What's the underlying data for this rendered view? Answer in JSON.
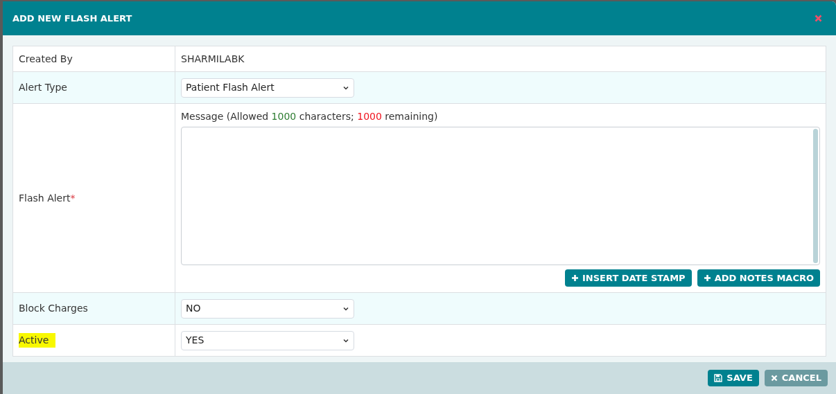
{
  "dialog": {
    "title": "ADD NEW FLASH ALERT"
  },
  "rows": [
    {
      "kind": "text",
      "label": "Created By",
      "value": "SHARMILABK",
      "highlighted": false
    },
    {
      "kind": "select",
      "label": "Alert Type",
      "value": "Patient Flash Alert",
      "highlighted": false
    },
    {
      "kind": "textarea",
      "label": "Flash Alert",
      "required_mark": "*",
      "highlighted": false,
      "counter": {
        "prefix": "Message (Allowed",
        "allowed": "1000",
        "middle": "characters;",
        "remaining": "1000",
        "suffix": "remaining)"
      },
      "buttons": [
        "INSERT DATE STAMP",
        "ADD NOTES MACRO"
      ]
    },
    {
      "kind": "select",
      "label": "Block Charges",
      "value": "NO",
      "highlighted": false
    },
    {
      "kind": "select",
      "label": "Active",
      "value": "YES",
      "highlighted": true
    }
  ],
  "footer": {
    "buttons": [
      {
        "kind": "save",
        "label": "SAVE"
      },
      {
        "kind": "cancel",
        "label": "CANCEL"
      }
    ]
  }
}
